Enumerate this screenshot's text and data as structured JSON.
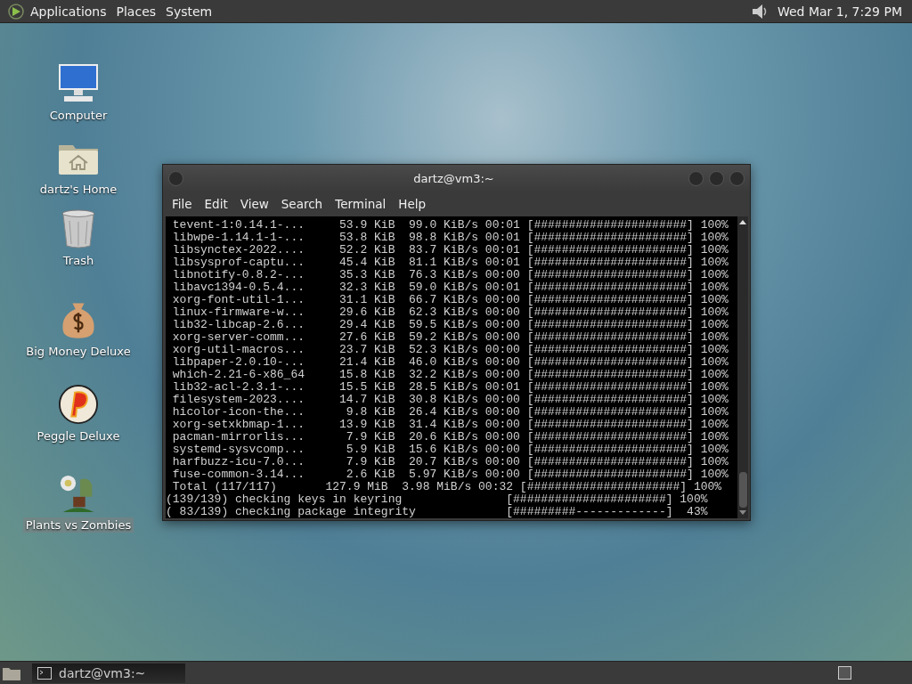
{
  "top_panel": {
    "menus": [
      "Applications",
      "Places",
      "System"
    ],
    "clock": "Wed Mar 1, 7:29 PM"
  },
  "desktop_icons": [
    {
      "label": "Computer",
      "selected": false
    },
    {
      "label": "dartz's Home",
      "selected": false
    },
    {
      "label": "Trash",
      "selected": false
    },
    {
      "label": "Big Money Deluxe",
      "selected": false
    },
    {
      "label": "Peggle Deluxe",
      "selected": false
    },
    {
      "label": "Plants vs Zombies",
      "selected": true
    }
  ],
  "terminal": {
    "title": "dartz@vm3:~",
    "menu": [
      "File",
      "Edit",
      "View",
      "Search",
      "Terminal",
      "Help"
    ],
    "lines": [
      " tevent-1:0.14.1-...     53.9 KiB  99.0 KiB/s 00:01 [######################] 100%",
      " libwpe-1.14.1-1-...     53.8 KiB  98.8 KiB/s 00:01 [######################] 100%",
      " libsynctex-2022....     52.2 KiB  83.7 KiB/s 00:01 [######################] 100%",
      " libsysprof-captu...     45.4 KiB  81.1 KiB/s 00:01 [######################] 100%",
      " libnotify-0.8.2-...     35.3 KiB  76.3 KiB/s 00:00 [######################] 100%",
      " libavc1394-0.5.4...     32.3 KiB  59.0 KiB/s 00:01 [######################] 100%",
      " xorg-font-util-1...     31.1 KiB  66.7 KiB/s 00:00 [######################] 100%",
      " linux-firmware-w...     29.6 KiB  62.3 KiB/s 00:00 [######################] 100%",
      " lib32-libcap-2.6...     29.4 KiB  59.5 KiB/s 00:00 [######################] 100%",
      " xorg-server-comm...     27.6 KiB  59.2 KiB/s 00:00 [######################] 100%",
      " xorg-util-macros...     23.7 KiB  52.3 KiB/s 00:00 [######################] 100%",
      " libpaper-2.0.10-...     21.4 KiB  46.0 KiB/s 00:00 [######################] 100%",
      " which-2.21-6-x86_64     15.8 KiB  32.2 KiB/s 00:00 [######################] 100%",
      " lib32-acl-2.3.1-...     15.5 KiB  28.5 KiB/s 00:01 [######################] 100%",
      " filesystem-2023....     14.7 KiB  30.8 KiB/s 00:00 [######################] 100%",
      " hicolor-icon-the...      9.8 KiB  26.4 KiB/s 00:00 [######################] 100%",
      " xorg-setxkbmap-1...     13.9 KiB  31.4 KiB/s 00:00 [######################] 100%",
      " pacman-mirrorlis...      7.9 KiB  20.6 KiB/s 00:00 [######################] 100%",
      " systemd-sysvcomp...      5.9 KiB  15.6 KiB/s 00:00 [######################] 100%",
      " harfbuzz-icu-7.0...      7.9 KiB  20.7 KiB/s 00:00 [######################] 100%",
      " fuse-common-3.14...      2.6 KiB  5.97 KiB/s 00:00 [######################] 100%",
      " Total (117/117)       127.9 MiB  3.98 MiB/s 00:32 [######################] 100%",
      "(139/139) checking keys in keyring               [######################] 100%",
      "( 83/139) checking package integrity             [#########-------------]  43%"
    ]
  },
  "taskbar": {
    "tasks": [
      {
        "label": "dartz@vm3:~",
        "selected": true
      }
    ]
  }
}
